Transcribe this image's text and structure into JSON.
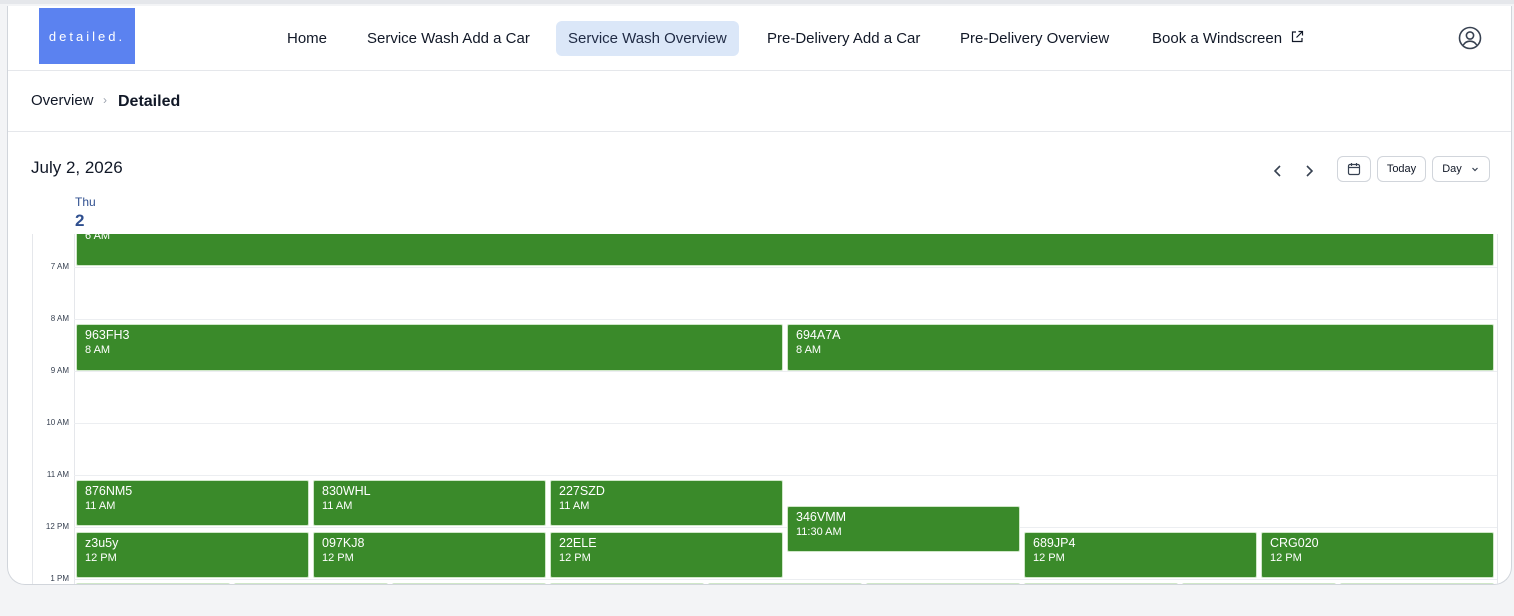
{
  "nav": {
    "logo": "detailed.",
    "items": [
      "Home",
      "Service Wash Add a Car",
      "Service Wash Overview",
      "Pre-Delivery Add a Car",
      "Pre-Delivery Overview",
      "Book a Windscreen"
    ],
    "active": "Service Wash Overview"
  },
  "breadcrumb": {
    "parent": "Overview",
    "current": "Detailed"
  },
  "calendar": {
    "date": "July 2, 2026",
    "day_name": "Thu",
    "day_number": "2",
    "today_label": "Today",
    "view_label": "Day",
    "hours": [
      "7 AM",
      "8 AM",
      "9 AM",
      "10 AM",
      "11 AM",
      "12 PM",
      "1 PM"
    ],
    "event_color": "#3a8a2a",
    "events": [
      {
        "title": "",
        "time": "6 AM"
      },
      {
        "title": "963FH3",
        "time": "8 AM"
      },
      {
        "title": "694A7A",
        "time": "8 AM"
      },
      {
        "title": "876NM5",
        "time": "11 AM"
      },
      {
        "title": "830WHL",
        "time": "11 AM"
      },
      {
        "title": "227SZD",
        "time": "11 AM"
      },
      {
        "title": "346VMM",
        "time": "11:30 AM"
      },
      {
        "title": "z3u5y",
        "time": "12 PM"
      },
      {
        "title": "097KJ8",
        "time": "12 PM"
      },
      {
        "title": "22ELE",
        "time": "12 PM"
      },
      {
        "title": "689JP4",
        "time": "12 PM"
      },
      {
        "title": "CRG020",
        "time": "12 PM"
      }
    ]
  }
}
